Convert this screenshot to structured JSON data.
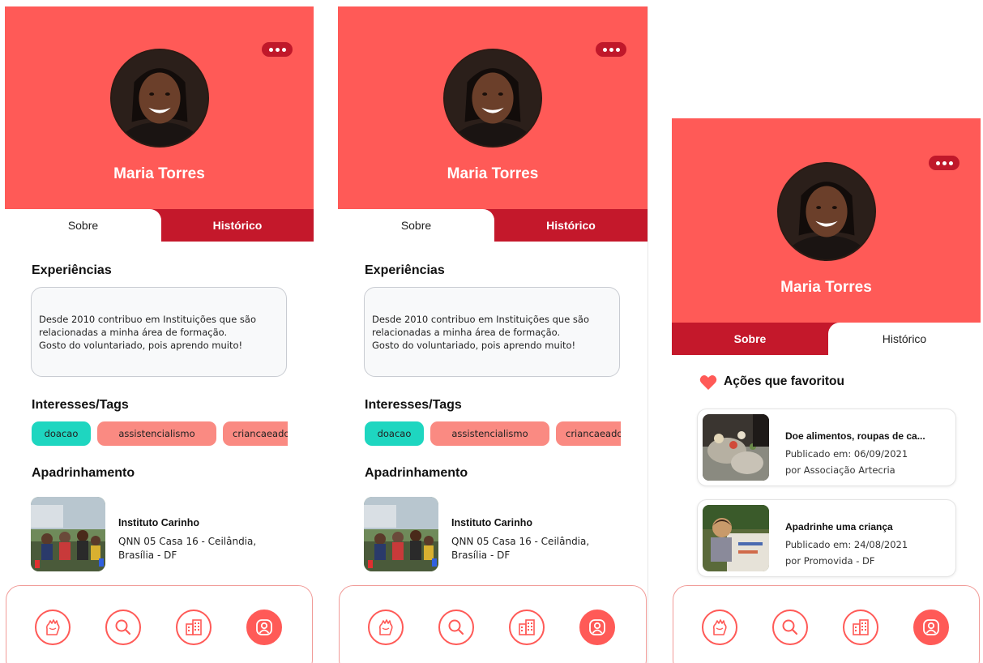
{
  "colors": {
    "header": "#ff5a57",
    "tab_bar": "#c4182b",
    "tag_teal": "#1ed6c0",
    "tag_salmon": "#fa8a82",
    "nav_border": "#f19b98"
  },
  "profile": {
    "name": "Maria Torres"
  },
  "tabs": {
    "about": "Sobre",
    "history": "Histórico"
  },
  "about": {
    "experiences_title": "Experiências",
    "experiences_text": "Desde 2010 contribuo em Instituições que são\nrelacionadas a minha área de formação.\nGosto do voluntariado, pois aprendo muito!",
    "interests_title": "Interesses/Tags",
    "tags": [
      "doacao",
      "assistencialismo",
      "criancaeado"
    ],
    "sponsorship_title": "Apadrinhamento",
    "sponsor": {
      "name": "Instituto Carinho",
      "address": "QNN 05 Casa 16 - Ceilândia, Brasília - DF"
    }
  },
  "history": {
    "favorites_title": "Ações que favoritou",
    "items": [
      {
        "title": "Doe alimentos, roupas de ca...",
        "date": "Publicado em: 06/09/2021",
        "org": "por Associação Artecria"
      },
      {
        "title": "Apadrinhe uma criança",
        "date": "Publicado em: 24/08/2021",
        "org": "por Promovida - DF"
      }
    ]
  },
  "nav": {
    "icons": [
      "hand-heart-icon",
      "search-icon",
      "building-icon",
      "profile-icon"
    ],
    "active": "profile-icon"
  }
}
